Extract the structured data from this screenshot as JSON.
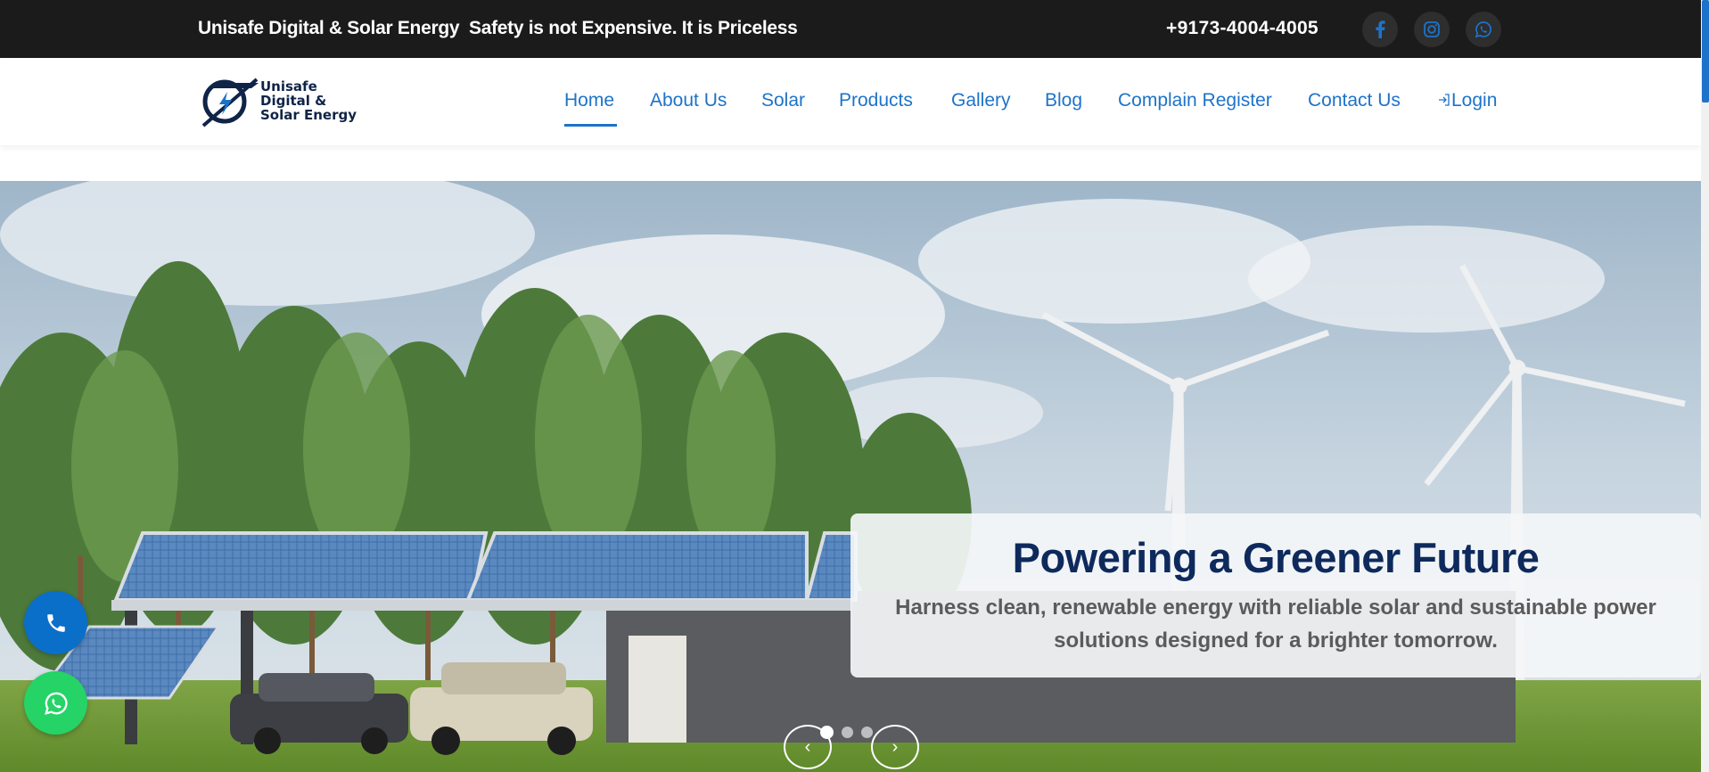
{
  "topbar": {
    "brand": "Unisafe Digital & Solar Energy",
    "tagline": "Safety is not Expensive. It is Priceless",
    "phone": "+9173-4004-4005",
    "social_icons": [
      "facebook-icon",
      "instagram-icon",
      "whatsapp-icon"
    ]
  },
  "logo": {
    "line1": "Unisafe",
    "line2": "Digital &",
    "line3": "Solar Energy"
  },
  "nav": {
    "items": [
      {
        "label": "Home",
        "active": true
      },
      {
        "label": "About Us"
      },
      {
        "label": "Solar"
      },
      {
        "label": "Products"
      },
      {
        "label": "Gallery"
      },
      {
        "label": "Blog"
      },
      {
        "label": "Complain Register"
      },
      {
        "label": "Contact Us"
      },
      {
        "label": "Login",
        "icon": "login-icon"
      }
    ]
  },
  "hero": {
    "title": "Powering a Greener Future",
    "subtitle": "Harness clean, renewable energy with reliable solar and sustainable power solutions designed for a brighter tomorrow.",
    "prev": "‹",
    "next": "›",
    "slides": 3,
    "active_slide": 1
  },
  "colors": {
    "accent": "#1d73c9",
    "topbar_bg": "#1b1b1b",
    "title": "#0e2a5c",
    "whatsapp": "#25d366"
  }
}
